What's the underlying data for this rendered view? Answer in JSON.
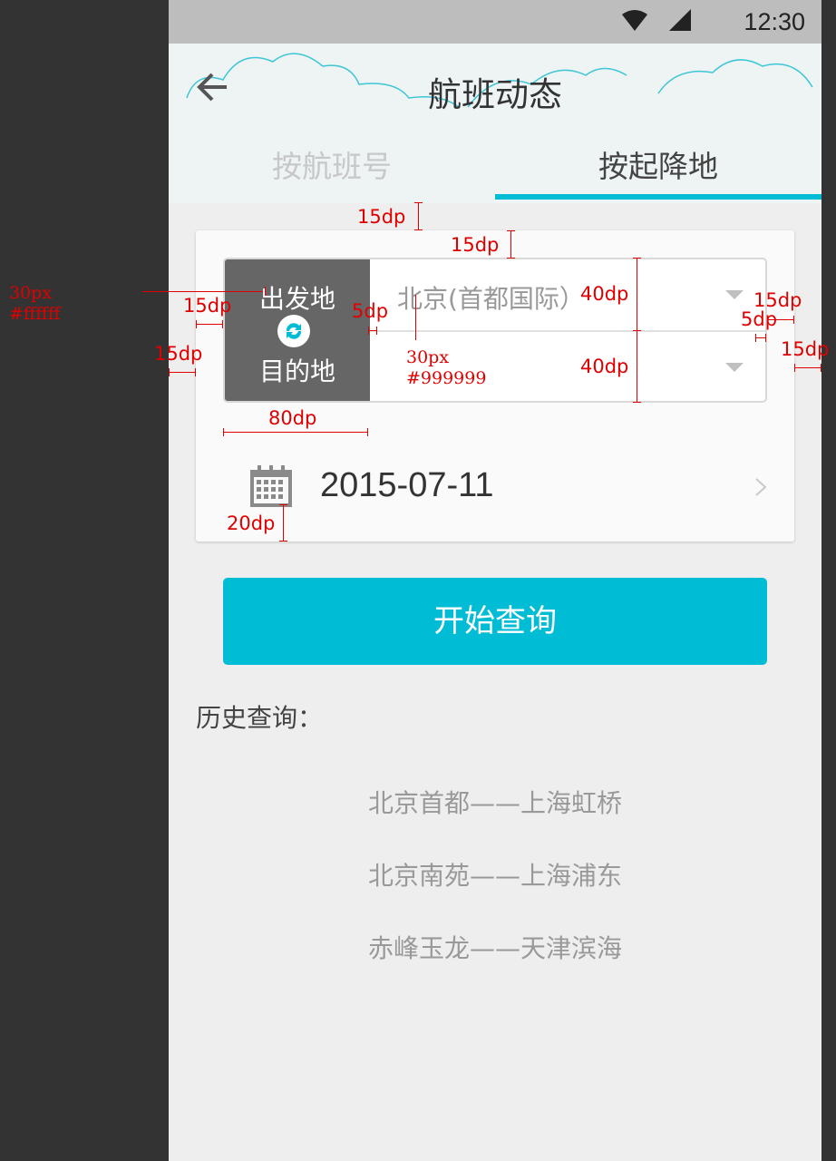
{
  "status_bar": {
    "time": "12:30"
  },
  "header": {
    "title": "航班动态"
  },
  "tabs": [
    {
      "label": "按航班号",
      "active": false
    },
    {
      "label": "按起降地",
      "active": true
    }
  ],
  "route": {
    "from_label": "出发地",
    "to_label": "目的地",
    "from_value": "北京(首都国际）",
    "to_value": ""
  },
  "date": {
    "value": "2015-07-11"
  },
  "search_button": {
    "label": "开始查询"
  },
  "history": {
    "title": "历史查询：",
    "items": [
      "北京首都——上海虹桥",
      "北京南苑——上海浦东",
      "赤峰玉龙——天津滨海"
    ]
  },
  "annotations": {
    "label_font": "30px",
    "label_color": "#ffffff",
    "value_font": "30px",
    "value_color": "#999999",
    "d15a": "15dp",
    "d15b": "15dp",
    "d15c": "15dp",
    "d15d": "15dp",
    "d15e": "15dp",
    "d5a": "5dp",
    "d5b": "5dp",
    "d40a": "40dp",
    "d40b": "40dp",
    "d80": "80dp",
    "d20": "20dp"
  },
  "colors": {
    "accent": "#00bcd4",
    "label_bg": "#666666",
    "status_bg": "#bdbdbd"
  }
}
